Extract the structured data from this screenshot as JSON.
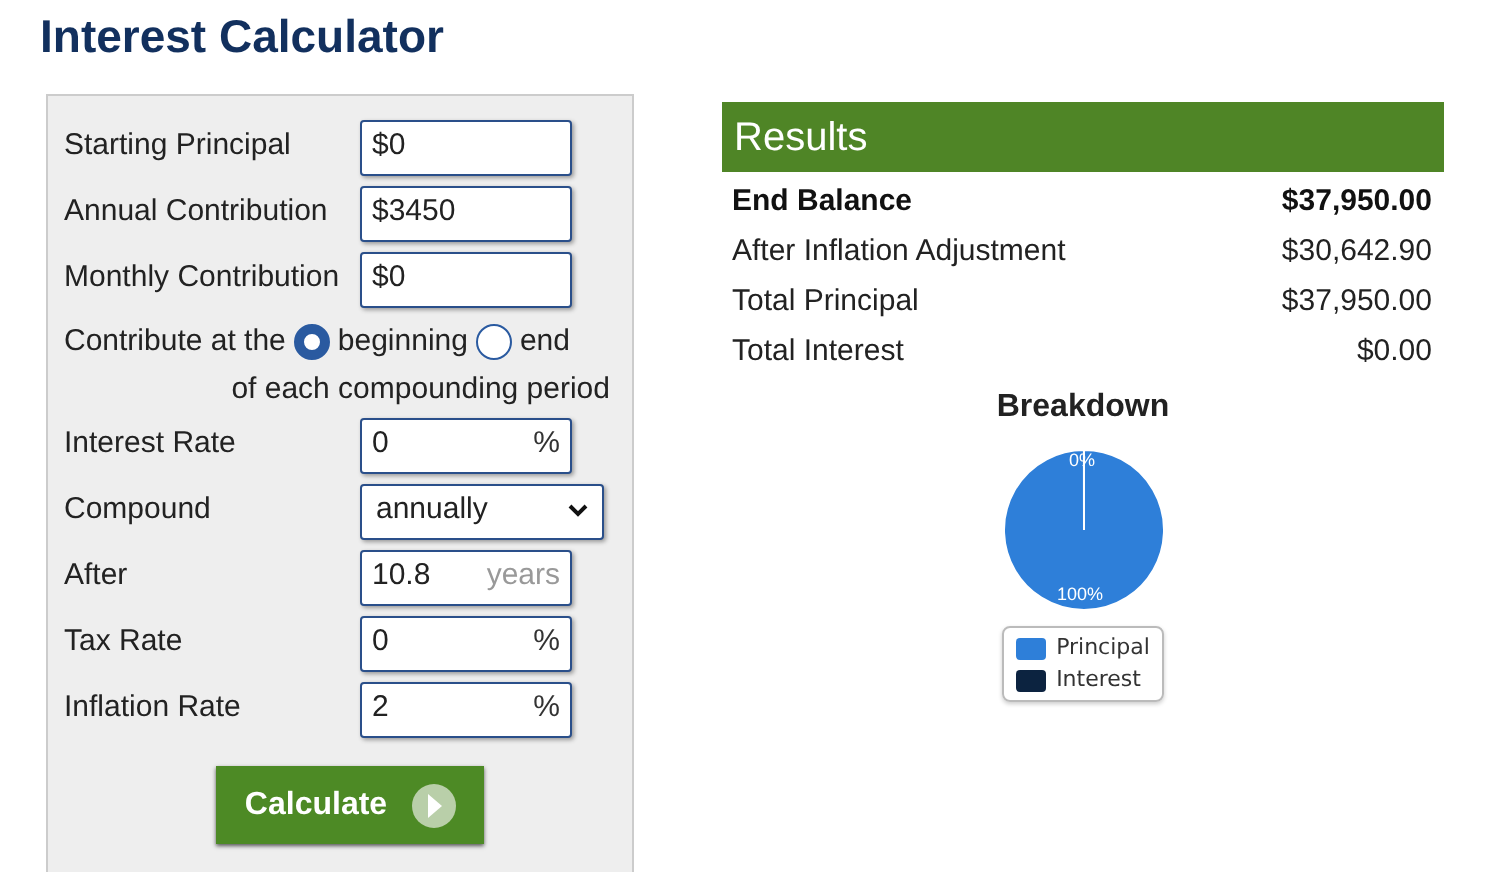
{
  "title": "Interest Calculator",
  "form": {
    "fields": [
      {
        "kind": "input",
        "label": "Starting Principal",
        "value": "$0"
      },
      {
        "kind": "input",
        "label": "Annual Contribution",
        "value": "$3450"
      },
      {
        "kind": "input",
        "label": "Monthly Contribution",
        "value": "$0"
      },
      {
        "kind": "radio",
        "label": "Contribute at the",
        "options": [
          {
            "label": "beginning",
            "selected": true
          },
          {
            "label": "end",
            "selected": false
          }
        ],
        "note": "of each compounding period"
      },
      {
        "kind": "input",
        "label": "Interest Rate",
        "value": "0",
        "suffix": "%"
      },
      {
        "kind": "select",
        "label": "Compound",
        "value": "annually"
      },
      {
        "kind": "input",
        "label": "After",
        "value": "10.8",
        "suffix": "years"
      },
      {
        "kind": "input",
        "label": "Tax Rate",
        "value": "0",
        "suffix": "%"
      },
      {
        "kind": "input",
        "label": "Inflation Rate",
        "value": "2",
        "suffix": "%"
      }
    ],
    "button": "Calculate"
  },
  "results": {
    "title": "Results",
    "rows": [
      {
        "label": "End Balance",
        "value": "$37,950.00",
        "bold": true
      },
      {
        "label": "After Inflation Adjustment",
        "value": "$30,642.90",
        "bold": false
      },
      {
        "label": "Total Principal",
        "value": "$37,950.00",
        "bold": false
      },
      {
        "label": "Total Interest",
        "value": "$0.00",
        "bold": false
      }
    ],
    "chart_data": {
      "type": "pie",
      "title": "Breakdown",
      "categories": [
        "Principal",
        "Interest"
      ],
      "values": [
        100,
        0
      ],
      "colors": [
        "#2e7fd9",
        "#0c2340"
      ],
      "value_labels": [
        "100%",
        "0%"
      ]
    }
  }
}
